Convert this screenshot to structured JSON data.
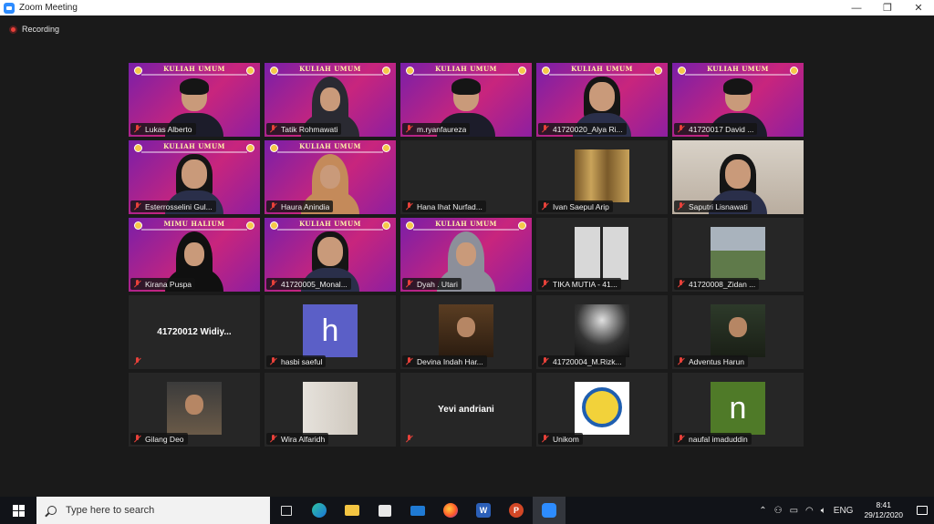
{
  "window": {
    "title": "Zoom Meeting",
    "minimize": "—",
    "restore": "❐",
    "close": "✕"
  },
  "recording": {
    "label": "Recording",
    "color": "#e8413a"
  },
  "banner": {
    "text": "KULIAH UMUM",
    "text_alt": "MIMU HALIUM"
  },
  "participants": [
    {
      "name": "Lukas Alberto",
      "tile": "banner",
      "avatar": "man"
    },
    {
      "name": "Tatik Rohmawati",
      "tile": "banner",
      "avatar": "woman-hijab-dark"
    },
    {
      "name": "m.ryanfaureza",
      "tile": "banner",
      "avatar": "man-hand"
    },
    {
      "name": "41720020_Alya Ri...",
      "tile": "banner",
      "avatar": "woman"
    },
    {
      "name": "41720017 David ...",
      "tile": "banner",
      "avatar": "man"
    },
    {
      "name": "Esterrosselini Gul...",
      "tile": "banner",
      "avatar": "woman"
    },
    {
      "name": "Haura Anindia",
      "tile": "banner",
      "avatar": "woman-hijab-tan"
    },
    {
      "name": "Hana Ihat Nurfad...",
      "tile": "blank",
      "avatar": "none"
    },
    {
      "name": "Ivan Saepul Arip",
      "tile": "thumb",
      "avatar": "curtain"
    },
    {
      "name": "Saputri Lisnawati",
      "tile": "photo",
      "avatar": "woman-room"
    },
    {
      "name": "Kirana Puspa",
      "tile": "banner-alt",
      "avatar": "woman-hijab-black"
    },
    {
      "name": "41720005_Monal...",
      "tile": "banner",
      "avatar": "woman"
    },
    {
      "name": "Dyah . Utari",
      "tile": "banner",
      "avatar": "woman-hijab-gray"
    },
    {
      "name": "TIKA MUTIA - 41...",
      "tile": "thumb",
      "avatar": "collage"
    },
    {
      "name": "41720008_Zidan ...",
      "tile": "thumb",
      "avatar": "landscape"
    },
    {
      "name": "41720012  Widiy...",
      "tile": "name-only",
      "avatar": "none"
    },
    {
      "name": "hasbi saeful",
      "tile": "letter",
      "avatar": "letter",
      "letter": "h",
      "color": "#5b5fc7"
    },
    {
      "name": "Devina Indah Har...",
      "tile": "thumb",
      "avatar": "mask"
    },
    {
      "name": "41720004_M.Rizk...",
      "tile": "thumb",
      "avatar": "concert"
    },
    {
      "name": "Adventus Harun",
      "tile": "thumb",
      "avatar": "thumbsup"
    },
    {
      "name": "Gilang Deo",
      "tile": "thumb",
      "avatar": "alley"
    },
    {
      "name": "Wira Alfaridh",
      "tile": "thumb",
      "avatar": "wall"
    },
    {
      "name": "Yevi andriani",
      "tile": "name-only",
      "avatar": "none"
    },
    {
      "name": "Unikom",
      "tile": "thumb",
      "avatar": "logo"
    },
    {
      "name": "naufal imaduddin",
      "tile": "letter",
      "avatar": "letter",
      "letter": "n",
      "color": "#4f7a28"
    }
  ],
  "taskbar": {
    "search_placeholder": "Type here to search",
    "apps": [
      "task-view",
      "edge",
      "file-explorer",
      "store",
      "mail",
      "firefox",
      "word",
      "powerpoint",
      "zoom"
    ],
    "word_glyph": "W",
    "ppt_glyph": "P",
    "lang": "ENG",
    "time": "8:41",
    "date": "29/12/2020"
  }
}
